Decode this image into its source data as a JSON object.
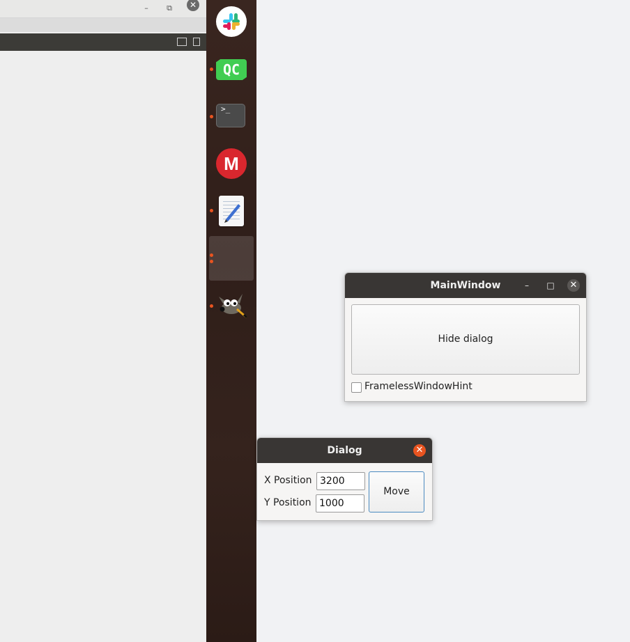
{
  "background_window": {
    "title_buttons": {
      "minimize": "–",
      "restore": "⧉",
      "close": "✕"
    }
  },
  "dock": {
    "apps": [
      {
        "name": "Slack",
        "icon": "slack-icon",
        "running": false
      },
      {
        "name": "Qt Creator",
        "icon": "qt-creator-icon",
        "label": "QC",
        "running": true
      },
      {
        "name": "Terminal",
        "icon": "terminal-icon",
        "label": ">_",
        "running": true
      },
      {
        "name": "MEGA",
        "icon": "mega-icon",
        "label": "M",
        "running": false
      },
      {
        "name": "Text Editor",
        "icon": "text-editor-icon",
        "running": true
      },
      {
        "name": "Active app slot",
        "icon": "blank-slot",
        "running": true
      },
      {
        "name": "GIMP",
        "icon": "gimp-icon",
        "running": true
      }
    ],
    "accent_color": "#e95420"
  },
  "main_window": {
    "title": "MainWindow",
    "controls": {
      "minimize": "–",
      "maximize": "□",
      "close": "✕"
    },
    "hide_button_label": "Hide dialog",
    "checkbox_label": "FramelessWindowHint",
    "checkbox_checked": false
  },
  "dialog": {
    "title": "Dialog",
    "close": "✕",
    "x_label": "X Position",
    "x_value": "3200",
    "y_label": "Y Position",
    "y_value": "1000",
    "move_label": "Move"
  }
}
